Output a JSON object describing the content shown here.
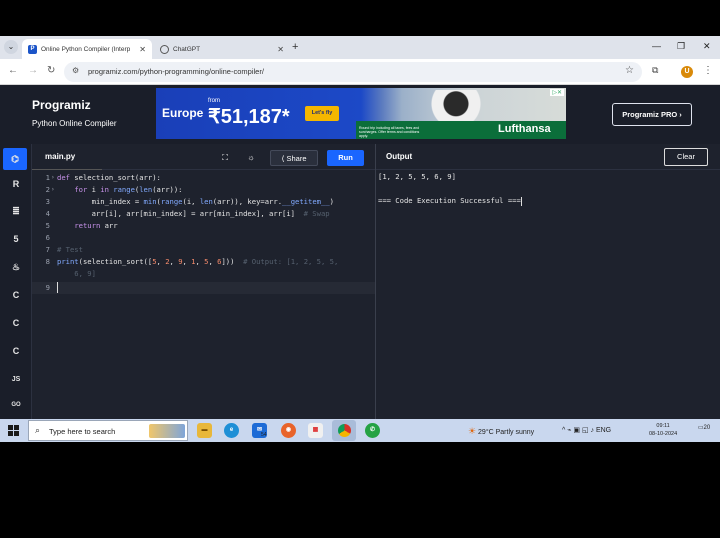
{
  "browser": {
    "tabs": [
      {
        "label": "Online Python Compiler (Interp",
        "icon": "programiz-favicon"
      },
      {
        "label": "ChatGPT",
        "icon": "chatgpt-favicon"
      }
    ],
    "url": "programiz.com/python-programming/online-compiler/",
    "avatar_letter": "U"
  },
  "header": {
    "logo": "Programiz",
    "subtitle": "Python Online Compiler",
    "pro_button": "Programiz PRO ›"
  },
  "ad": {
    "destination": "Europe",
    "from_label": "from",
    "price": "₹51,187*",
    "cta": "Let's fly",
    "fine_print": "Round trip including all taxes, fees and surcharges. Offer terms and conditions apply.",
    "brand": "Lufthansa"
  },
  "sidebar": {
    "items": [
      {
        "label": "",
        "icon": "python-icon"
      },
      {
        "label": "R",
        "icon": "r-lang-icon"
      },
      {
        "label": "",
        "icon": "sql-icon"
      },
      {
        "label": "5",
        "icon": "html5-icon"
      },
      {
        "label": "",
        "icon": "java-icon"
      },
      {
        "label": "C",
        "icon": "c-lang-icon"
      },
      {
        "label": "C",
        "icon": "cpp-lang-icon"
      },
      {
        "label": "C",
        "icon": "csharp-lang-icon"
      },
      {
        "label": "JS",
        "icon": "javascript-icon"
      },
      {
        "label": "GO",
        "icon": "go-lang-icon"
      }
    ]
  },
  "editor": {
    "filename": "main.py",
    "share_label": "Share",
    "run_label": "Run",
    "lines": [
      {
        "n": "1",
        "text": "def selection_sort(arr):"
      },
      {
        "n": "2",
        "text": "    for i in range(len(arr)):"
      },
      {
        "n": "3",
        "text": "        min_index = min(range(i, len(arr)), key=arr.__getitem__)"
      },
      {
        "n": "4",
        "text": "        arr[i], arr[min_index] = arr[min_index], arr[i]  # Swap"
      },
      {
        "n": "5",
        "text": "    return arr"
      },
      {
        "n": "6",
        "text": ""
      },
      {
        "n": "7",
        "text": "# Test"
      },
      {
        "n": "8",
        "text": "print(selection_sort([5, 2, 9, 1, 5, 6]))  # Output: [1, 2, 5, 5,"
      },
      {
        "n": "",
        "text": "    6, 9]"
      },
      {
        "n": "9",
        "text": ""
      }
    ]
  },
  "output": {
    "title": "Output",
    "clear_label": "Clear",
    "lines": [
      "[1, 2, 5, 5, 6, 9]",
      "",
      "=== Code Execution Successful ==="
    ]
  },
  "taskbar": {
    "search_placeholder": "Type here to search",
    "mail_badge": "54",
    "weather": "29°C  Partly sunny",
    "lang": "ENG",
    "time": "09:11",
    "date": "08-10-2024",
    "notification_count": "20"
  }
}
